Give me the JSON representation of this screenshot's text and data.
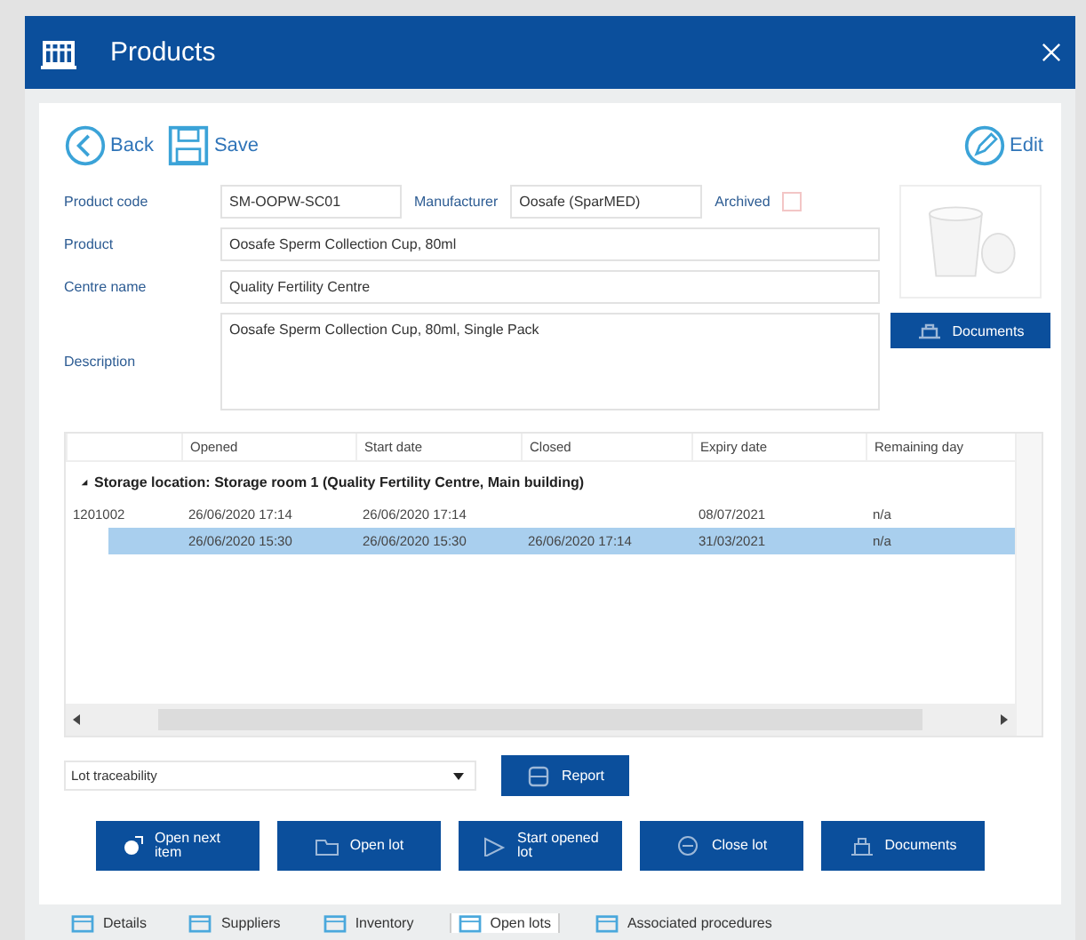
{
  "window": {
    "title": "Products"
  },
  "toolbar": {
    "back": "Back",
    "save": "Save",
    "edit": "Edit"
  },
  "form": {
    "product_code_label": "Product code",
    "product_code": "SM-OOPW-SC01",
    "manufacturer_label": "Manufacturer",
    "manufacturer": "Oosafe (SparMED)",
    "archived_label": "Archived",
    "archived": false,
    "product_label": "Product",
    "product": "Oosafe Sperm Collection Cup, 80ml",
    "centre_label": "Centre name",
    "centre": "Quality Fertility Centre",
    "description_label": "Description",
    "description": "Oosafe Sperm Collection Cup, 80ml, Single Pack",
    "documents_button": "Documents"
  },
  "table": {
    "columns": [
      "",
      "Opened",
      "Start date",
      "Closed",
      "Expiry date",
      "Remaining day"
    ],
    "group": {
      "label": "Storage location: Storage room 1 (Quality Fertility Centre, Main building)",
      "expanded": true
    },
    "rows": [
      {
        "cells": [
          "1201002",
          "26/06/2020 17:14",
          "26/06/2020 17:14",
          "",
          "08/07/2021",
          "n/a"
        ],
        "selected": false
      },
      {
        "cells": [
          "",
          "26/06/2020 15:30",
          "26/06/2020 15:30",
          "26/06/2020 17:14",
          "31/03/2021",
          "n/a"
        ],
        "selected": true
      }
    ]
  },
  "report": {
    "dropdown": "Lot traceability",
    "button": "Report"
  },
  "actions": [
    {
      "label": "Open next item",
      "kind": "open-next"
    },
    {
      "label": "Open lot",
      "kind": "open"
    },
    {
      "label": "Start opened lot",
      "kind": "start"
    },
    {
      "label": "Close lot",
      "kind": "close"
    },
    {
      "label": "Documents",
      "kind": "documents"
    }
  ],
  "tabs": [
    {
      "label": "Details",
      "selected": false
    },
    {
      "label": "Suppliers",
      "selected": false
    },
    {
      "label": "Inventory",
      "selected": false
    },
    {
      "label": "Open lots",
      "selected": true
    },
    {
      "label": "Associated procedures",
      "selected": false
    }
  ]
}
